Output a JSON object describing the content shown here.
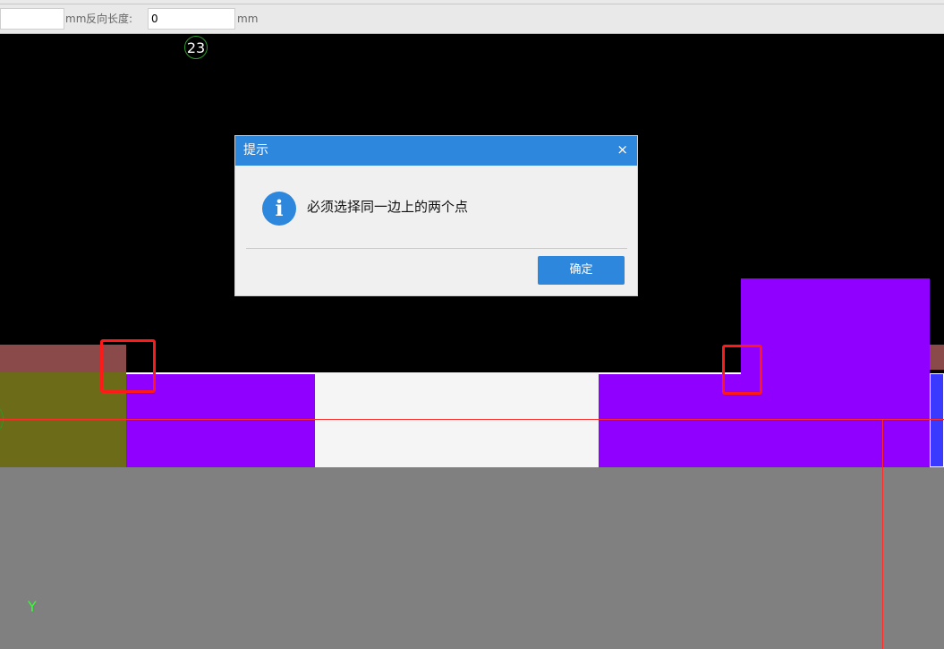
{
  "toolbar": {
    "first_input_value": "",
    "unit_label": "mm",
    "reverse_length_label": "反向长度:",
    "reverse_length_value": "0",
    "second_unit_label": "mm"
  },
  "canvas": {
    "point_number": "23",
    "axis_label": "Y"
  },
  "dialog": {
    "title": "提示",
    "close_symbol": "×",
    "icon_glyph": "i",
    "message": "必须选择同一边上的两个点",
    "confirm_label": "确定"
  },
  "colors": {
    "canvas_background": "#000000",
    "gray_region": "#808080",
    "purple_region": "#8f00ff",
    "white_region": "#f5f5f5",
    "olive_region": "#6b6b18",
    "brown_strip": "#8a4a4a",
    "blue_region": "#3a3aff",
    "crosshair": "#ff2a2a",
    "highlight_box": "#ff1a1a",
    "dialog_header": "#2d87dd"
  }
}
